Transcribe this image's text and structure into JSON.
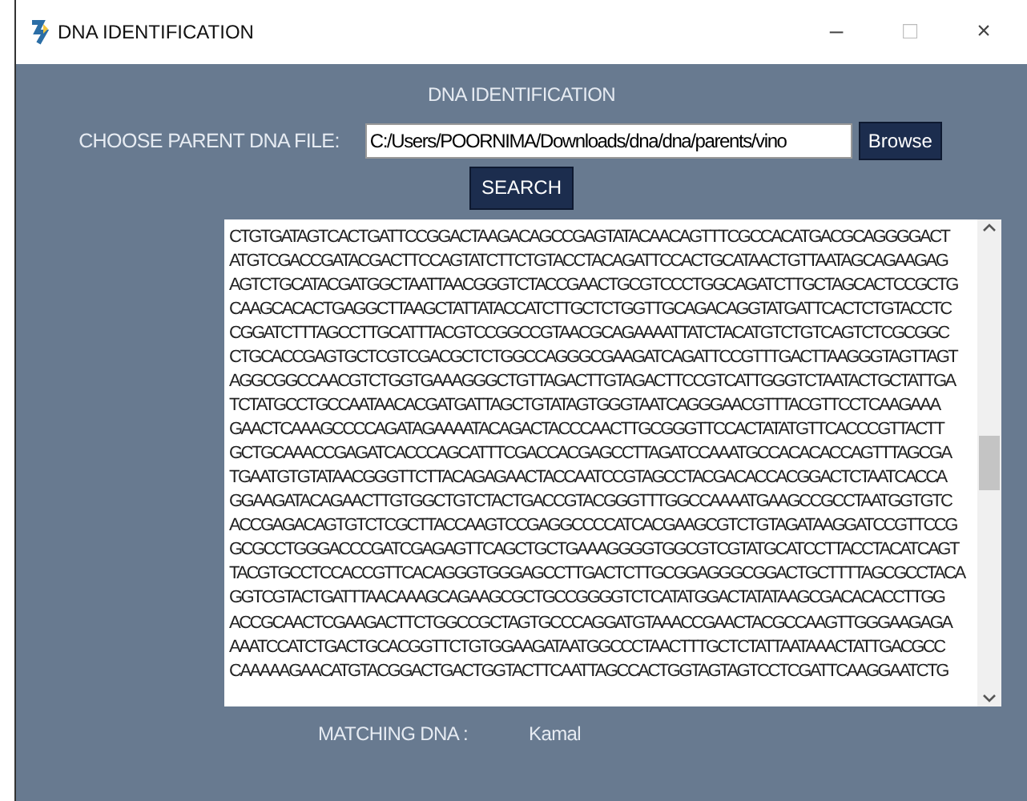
{
  "window": {
    "title": "DNA IDENTIFICATION",
    "controls": [
      "–",
      "□",
      "×"
    ]
  },
  "heading": "DNA IDENTIFICATION",
  "file": {
    "label": "CHOOSE PARENT DNA FILE:",
    "value": "C:/Users/POORNIMA/Downloads/dna/dna/parents/vino",
    "button": "Browse"
  },
  "search_button": "SEARCH",
  "sequence_lines": [
    "CTGTGATAGTCACTGATTCCGGACTAAGACAGCCGAGTATACAACAGTTTCGCCACATGACGCAGGGGACT",
    "ATGTCGACCGATACGACTTCCAGTATCTTCTGTACCTACAGATTCCACTGCATAACTGTTAATAGCAGAAGAG",
    "AGTCTGCATACGATGGCTAATTAACGGGTCTACCGAACTGCGTCCCTGGCAGATCTTGCTAGCACTCCGCTG",
    "CAAGCACACTGAGGCTTAAGCTATTATACCATCTTGCTCTGGTTGCAGACAGGTATGATTCACTCTGTACCTC",
    "CGGATCTTTAGCCTTGCATTTACGTCCGGCCGTAACGCAGAAAATTATCTACATGTCTGTCAGTCTCGCGGC",
    "CTGCACCGAGTGCTCGTCGACGCTCTGGCCAGGGCGAAGATCAGATTCCGTTTGACTTAAGGGTAGTTAGT",
    "AGGCGGCCAACGTCTGGTGAAAGGGCTGTTAGACTTGTAGACTTCCGTCATTGGGTCTAATACTGCTATTGA",
    "TCTATGCCTGCCAATAACACGATGATTAGCTGTATAGTGGGTAATCAGGGAACGTTTACGTTCCTCAAGAAA",
    "GAACTCAAAGCCCCAGATAGAAAATACAGACTACCCAACTTGCGGGTTCCACTATATGTTCACCCGTTACTT",
    "GCTGCAAACCGAGATCACCCAGCATTTCGACCACGAGCCTTAGATCCAAATGCCACACACCAGTTTAGCGA",
    "TGAATGTGTATAACGGGTTCTTACAGAGAACTACCAATCCGTAGCCTACGACACCACGGACTCTAATCACCA",
    "GGAAGATACAGAACTTGTGGCTGTCTACTGACCGTACGGGTTTGGCCAAAATGAAGCCGCCTAATGGTGTC",
    "ACCGAGACAGTGTCTCGCTTACCAAGTCCGAGGCCCCATCACGAAGCGTCTGTAGATAAGGATCCGTTCCG",
    "GCGCCTGGGACCCGATCGAGAGTTCAGCTGCTGAAAGGGGTGGCGTCGTATGCATCCTTACCTACATCAGT",
    "TACGTGCCTCCACCGTTCACAGGGTGGGAGCCTTGACTCTTGCGGAGGGCGGACTGCTTTTAGCGCCTACA",
    "GGTCGTACTGATTTAACAAAGCAGAAGCGCTGCCGGGGTCTCATATGGACTATATAAGCGACACACCTTGG",
    "ACCGCAACTCGAAGACTTCTGGCCGCTAGTGCCCAGGATGTAAACCGAACTACGCCAAGTTGGGAAGAGA",
    "AAATCCATCTGACTGCACGGTTCTGTGGAAGATAATGGCCCTAACTTTGCTCTATTAATAAACTATTGACGCC",
    "CAAAAAGAACATGTACGGACTGACTGGTACTTCAATTAGCCACTGGTAGTAGTCCTCGATTCAAGGAATCTG"
  ],
  "result": {
    "label": "MATCHING DNA :",
    "value": "Kamal"
  }
}
